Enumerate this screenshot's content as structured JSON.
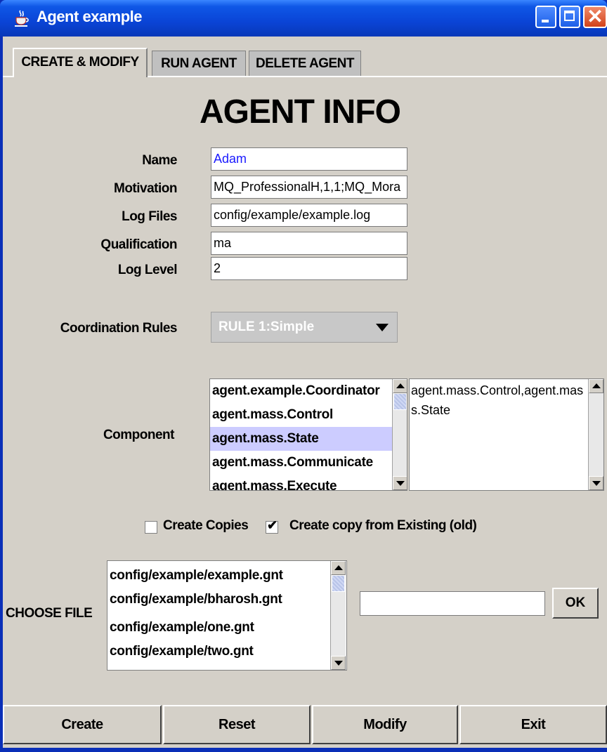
{
  "window": {
    "title": "Agent example",
    "icons": {
      "app": "java-cup-icon",
      "minimize": "minimize-icon",
      "maximize": "maximize-icon",
      "close": "close-icon"
    }
  },
  "tabs": [
    {
      "label": "CREATE & MODIFY",
      "active": true
    },
    {
      "label": "RUN AGENT",
      "active": false
    },
    {
      "label": "DELETE AGENT",
      "active": false
    }
  ],
  "heading": "AGENT INFO",
  "form": {
    "name_label": "Name",
    "name_value": "Adam",
    "motivation_label": "Motivation",
    "motivation_value": "MQ_ProfessionalH,1,1;MQ_Mora",
    "logfiles_label": "Log Files",
    "logfiles_value": "config/example/example.log",
    "qualification_label": "Qualification",
    "qualification_value": "ma",
    "loglevel_label": "Log Level",
    "loglevel_value": "2"
  },
  "coordination": {
    "label": "Coordination Rules",
    "selected": "RULE 1:Simple"
  },
  "component": {
    "label": "Component",
    "items": [
      "agent.example.Coordinator",
      "agent.mass.Control",
      "agent.mass.State",
      "agent.mass.Communicate",
      "agent.mass.Execute"
    ],
    "selected_index": 2,
    "selected_text": "agent.mass.Control,agent.mass.State"
  },
  "options": {
    "create_copies_label": "Create Copies",
    "create_copies_checked": false,
    "copy_existing_label": "Create copy from Existing (old)",
    "copy_existing_checked": true
  },
  "choose_file": {
    "label": "CHOOSE FILE",
    "files": [
      "config/example/example.gnt",
      "config/example/bharosh.gnt",
      "config/example/one.gnt",
      "config/example/two.gnt"
    ],
    "input_value": "",
    "ok_label": "OK"
  },
  "buttons": {
    "create": "Create",
    "reset": "Reset",
    "modify": "Modify",
    "exit": "Exit"
  },
  "colors": {
    "titlebar": "#0a44d6",
    "panel": "#d4d0c8",
    "selection": "#ccccff",
    "name_text": "#1a1aff",
    "close_button": "#d2421a"
  }
}
